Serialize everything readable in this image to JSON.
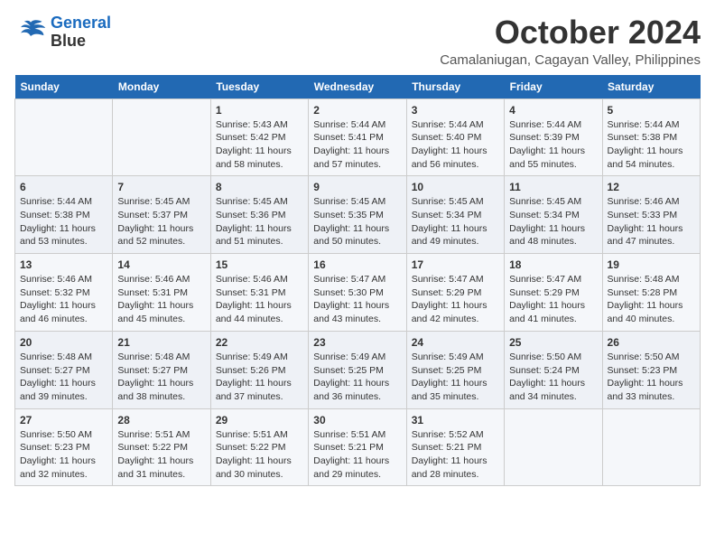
{
  "logo": {
    "line1": "General",
    "line2": "Blue"
  },
  "title": "October 2024",
  "subtitle": "Camalaniugan, Cagayan Valley, Philippines",
  "weekdays": [
    "Sunday",
    "Monday",
    "Tuesday",
    "Wednesday",
    "Thursday",
    "Friday",
    "Saturday"
  ],
  "weeks": [
    [
      {
        "day": "",
        "info": ""
      },
      {
        "day": "",
        "info": ""
      },
      {
        "day": "1",
        "info": "Sunrise: 5:43 AM\nSunset: 5:42 PM\nDaylight: 11 hours and 58 minutes."
      },
      {
        "day": "2",
        "info": "Sunrise: 5:44 AM\nSunset: 5:41 PM\nDaylight: 11 hours and 57 minutes."
      },
      {
        "day": "3",
        "info": "Sunrise: 5:44 AM\nSunset: 5:40 PM\nDaylight: 11 hours and 56 minutes."
      },
      {
        "day": "4",
        "info": "Sunrise: 5:44 AM\nSunset: 5:39 PM\nDaylight: 11 hours and 55 minutes."
      },
      {
        "day": "5",
        "info": "Sunrise: 5:44 AM\nSunset: 5:38 PM\nDaylight: 11 hours and 54 minutes."
      }
    ],
    [
      {
        "day": "6",
        "info": "Sunrise: 5:44 AM\nSunset: 5:38 PM\nDaylight: 11 hours and 53 minutes."
      },
      {
        "day": "7",
        "info": "Sunrise: 5:45 AM\nSunset: 5:37 PM\nDaylight: 11 hours and 52 minutes."
      },
      {
        "day": "8",
        "info": "Sunrise: 5:45 AM\nSunset: 5:36 PM\nDaylight: 11 hours and 51 minutes."
      },
      {
        "day": "9",
        "info": "Sunrise: 5:45 AM\nSunset: 5:35 PM\nDaylight: 11 hours and 50 minutes."
      },
      {
        "day": "10",
        "info": "Sunrise: 5:45 AM\nSunset: 5:34 PM\nDaylight: 11 hours and 49 minutes."
      },
      {
        "day": "11",
        "info": "Sunrise: 5:45 AM\nSunset: 5:34 PM\nDaylight: 11 hours and 48 minutes."
      },
      {
        "day": "12",
        "info": "Sunrise: 5:46 AM\nSunset: 5:33 PM\nDaylight: 11 hours and 47 minutes."
      }
    ],
    [
      {
        "day": "13",
        "info": "Sunrise: 5:46 AM\nSunset: 5:32 PM\nDaylight: 11 hours and 46 minutes."
      },
      {
        "day": "14",
        "info": "Sunrise: 5:46 AM\nSunset: 5:31 PM\nDaylight: 11 hours and 45 minutes."
      },
      {
        "day": "15",
        "info": "Sunrise: 5:46 AM\nSunset: 5:31 PM\nDaylight: 11 hours and 44 minutes."
      },
      {
        "day": "16",
        "info": "Sunrise: 5:47 AM\nSunset: 5:30 PM\nDaylight: 11 hours and 43 minutes."
      },
      {
        "day": "17",
        "info": "Sunrise: 5:47 AM\nSunset: 5:29 PM\nDaylight: 11 hours and 42 minutes."
      },
      {
        "day": "18",
        "info": "Sunrise: 5:47 AM\nSunset: 5:29 PM\nDaylight: 11 hours and 41 minutes."
      },
      {
        "day": "19",
        "info": "Sunrise: 5:48 AM\nSunset: 5:28 PM\nDaylight: 11 hours and 40 minutes."
      }
    ],
    [
      {
        "day": "20",
        "info": "Sunrise: 5:48 AM\nSunset: 5:27 PM\nDaylight: 11 hours and 39 minutes."
      },
      {
        "day": "21",
        "info": "Sunrise: 5:48 AM\nSunset: 5:27 PM\nDaylight: 11 hours and 38 minutes."
      },
      {
        "day": "22",
        "info": "Sunrise: 5:49 AM\nSunset: 5:26 PM\nDaylight: 11 hours and 37 minutes."
      },
      {
        "day": "23",
        "info": "Sunrise: 5:49 AM\nSunset: 5:25 PM\nDaylight: 11 hours and 36 minutes."
      },
      {
        "day": "24",
        "info": "Sunrise: 5:49 AM\nSunset: 5:25 PM\nDaylight: 11 hours and 35 minutes."
      },
      {
        "day": "25",
        "info": "Sunrise: 5:50 AM\nSunset: 5:24 PM\nDaylight: 11 hours and 34 minutes."
      },
      {
        "day": "26",
        "info": "Sunrise: 5:50 AM\nSunset: 5:23 PM\nDaylight: 11 hours and 33 minutes."
      }
    ],
    [
      {
        "day": "27",
        "info": "Sunrise: 5:50 AM\nSunset: 5:23 PM\nDaylight: 11 hours and 32 minutes."
      },
      {
        "day": "28",
        "info": "Sunrise: 5:51 AM\nSunset: 5:22 PM\nDaylight: 11 hours and 31 minutes."
      },
      {
        "day": "29",
        "info": "Sunrise: 5:51 AM\nSunset: 5:22 PM\nDaylight: 11 hours and 30 minutes."
      },
      {
        "day": "30",
        "info": "Sunrise: 5:51 AM\nSunset: 5:21 PM\nDaylight: 11 hours and 29 minutes."
      },
      {
        "day": "31",
        "info": "Sunrise: 5:52 AM\nSunset: 5:21 PM\nDaylight: 11 hours and 28 minutes."
      },
      {
        "day": "",
        "info": ""
      },
      {
        "day": "",
        "info": ""
      }
    ]
  ]
}
